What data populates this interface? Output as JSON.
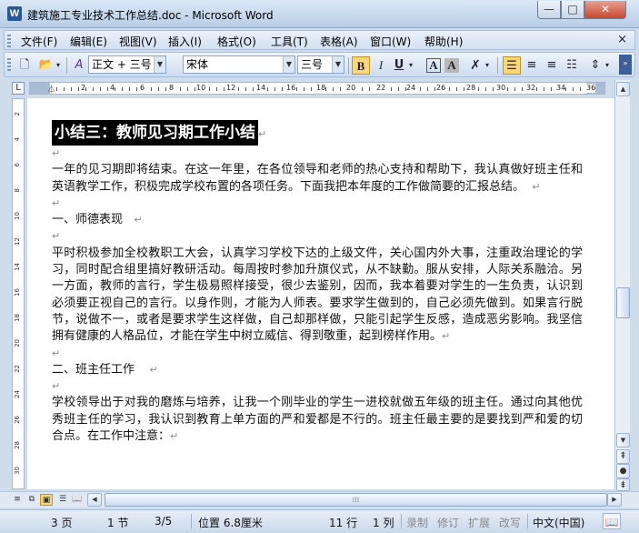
{
  "window": {
    "title": "建筑施工专业技术工作总结.doc - Microsoft Word",
    "app_icon": "W",
    "min_icon": "minimize-icon",
    "max_icon": "maximize-icon",
    "close_icon": "close-icon"
  },
  "menu": {
    "items": [
      "文件(F)",
      "编辑(E)",
      "视图(V)",
      "插入(I)",
      "格式(O)",
      "工具(T)",
      "表格(A)",
      "窗口(W)",
      "帮助(H)"
    ],
    "close_doc": "×"
  },
  "toolbar": {
    "style_value": "正文 + 三号",
    "font_value": "宋体",
    "size_value": "三号",
    "bold": "B",
    "italic": "I",
    "underline": "U",
    "font_color": "A",
    "char_border": "A",
    "char_shading": "A"
  },
  "ruler": {
    "numbers": [
      "2",
      "4",
      "6",
      "8",
      "10",
      "12",
      "14",
      "16",
      "18",
      "20",
      "22",
      "24",
      "26",
      "28",
      "30",
      "32",
      "34",
      "36"
    ],
    "corner": "L"
  },
  "vruler": {
    "numbers": [
      "2",
      "4",
      "6",
      "8",
      "10",
      "12",
      "14",
      "16",
      "18",
      "20",
      "22",
      "24",
      "26",
      "28",
      "30"
    ]
  },
  "document": {
    "title": "小结三：教师见习期工作小结",
    "para_mark": "↵",
    "p1": "一年的见习期即将结束。在这一年里，在各位领导和老师的热心支持和帮助下，我认真做好班主任和英语教学工作，积极完成学校布置的各项任务。下面我把本年度的工作做简要的汇报总结。",
    "h1": "一、师德表现",
    "p2": "平时积极参加全校教职工大会，认真学习学校下达的上级文件，关心国内外大事，注重政治理论的学习，同时配合组里搞好教研活动。每周按时参加升旗仪式，从不缺勤。服从安排，人际关系融洽。另一方面，教师的言行，学生极易照样接受，很少去鉴别，因而，我本着要对学生的一生负责，认识到必须要正视自己的言行。以身作则，才能为人师表。要求学生做到的，自己必须先做到。如果言行脱节，说做不一，或者是要求学生这样做，自己却那样做，只能引起学生反感，造成恶劣影响。我坚信拥有健康的人格品位，才能在学生中树立威信、得到敬重，起到榜样作用。",
    "h2": "二、班主任工作",
    "p3": "学校领导出于对我的磨炼与培养，让我一个刚毕业的学生一进校就做五年级的班主任。通过向其他优秀班主任的学习，我认识到教育上单方面的严和爱都是不行的。班主任最主要的是要找到严和爱的切合点。在工作中注意："
  },
  "statusbar": {
    "page": "3 页",
    "section": "1 节",
    "page_of": "3/5",
    "position": "位置 6.8厘米",
    "line": "11 行",
    "column": "1 列",
    "rec": "录制",
    "trk": "修订",
    "ext": "扩展",
    "ovr": "改写",
    "language": "中文(中国)"
  }
}
